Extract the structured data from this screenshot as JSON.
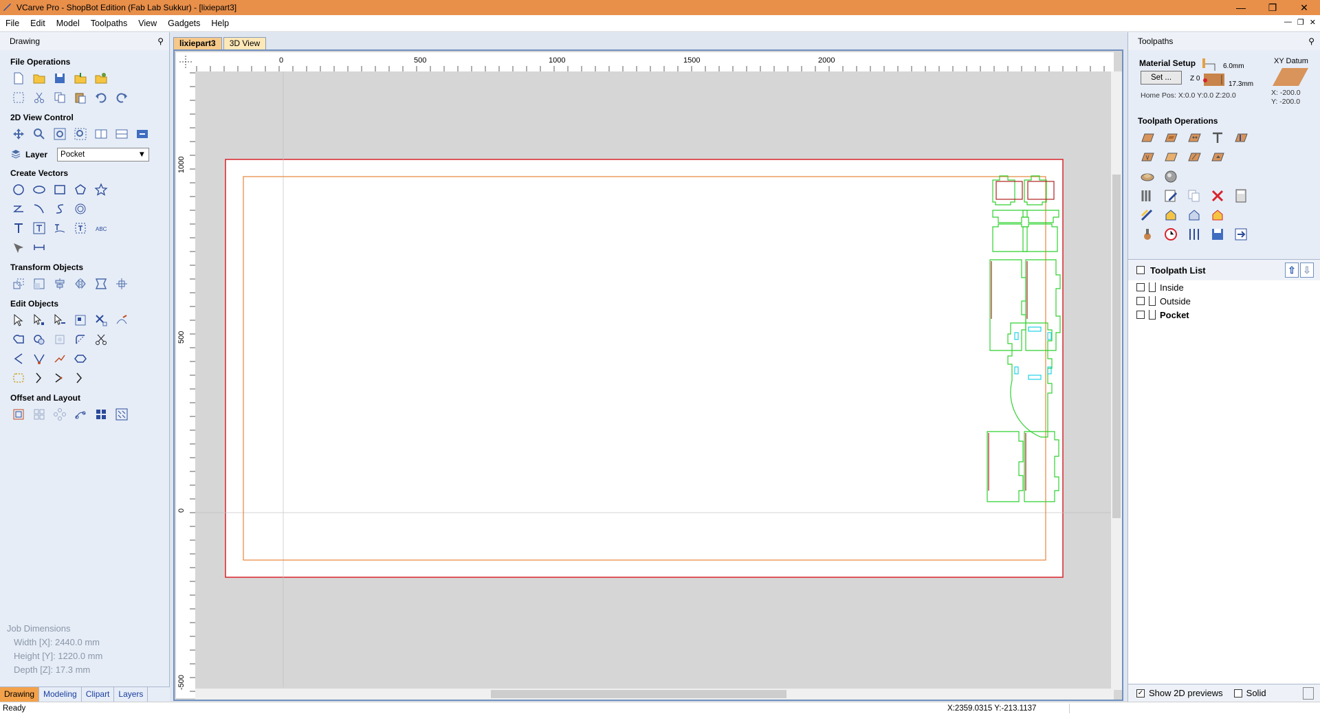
{
  "window": {
    "title": "VCarve Pro - ShopBot Edition (Fab Lab Sukkur) - [lixiepart3]"
  },
  "menu": [
    "File",
    "Edit",
    "Model",
    "Toolpaths",
    "View",
    "Gadgets",
    "Help"
  ],
  "left_panel": {
    "title": "Drawing",
    "sections": {
      "file_operations": "File Operations",
      "view_control": "2D View Control",
      "create_vectors": "Create Vectors",
      "transform_objects": "Transform Objects",
      "edit_objects": "Edit Objects",
      "offset_layout": "Offset and Layout"
    },
    "layer": {
      "label": "Layer",
      "value": "Pocket"
    },
    "job_dimensions": {
      "title": "Job Dimensions",
      "width": "Width  [X]: 2440.0 mm",
      "height": "Height [Y]: 1220.0 mm",
      "depth": "Depth  [Z]: 17.3 mm"
    },
    "tabs": [
      "Drawing",
      "Modeling",
      "Clipart",
      "Layers"
    ]
  },
  "doc_tabs": [
    "lixiepart3",
    "3D View"
  ],
  "rulers": {
    "top": [
      "0",
      "500",
      "1000",
      "1500",
      "2000"
    ],
    "left": [
      "1000",
      "500",
      "0",
      "-500"
    ]
  },
  "right_panel": {
    "title": "Toolpaths",
    "material_setup": {
      "title": "Material Setup",
      "set_button": "Set ...",
      "z_label": "Z 0",
      "dim_top": "6.0mm",
      "dim_bottom": "17.3mm",
      "home_pos": "Home Pos:  X:0.0 Y:0.0 Z:20.0",
      "xy_datum": "XY Datum",
      "x": "X: -200.0",
      "y": "Y: -200.0"
    },
    "toolpath_operations": "Toolpath Operations",
    "toolpath_list": {
      "title": "Toolpath List",
      "items": [
        "Inside",
        "Outside",
        "Pocket"
      ]
    },
    "show_2d_previews": "Show 2D previews",
    "solid": "Solid"
  },
  "status": {
    "text": "Ready",
    "coords": "X:2359.0315 Y:-213.1137"
  },
  "colors": {
    "title_bar": "#e88f4a",
    "material_outline": "#d9222a",
    "orange_outline": "#e8843a",
    "parts": "#2ed12e",
    "cyan_holes": "#1fd3e6"
  }
}
